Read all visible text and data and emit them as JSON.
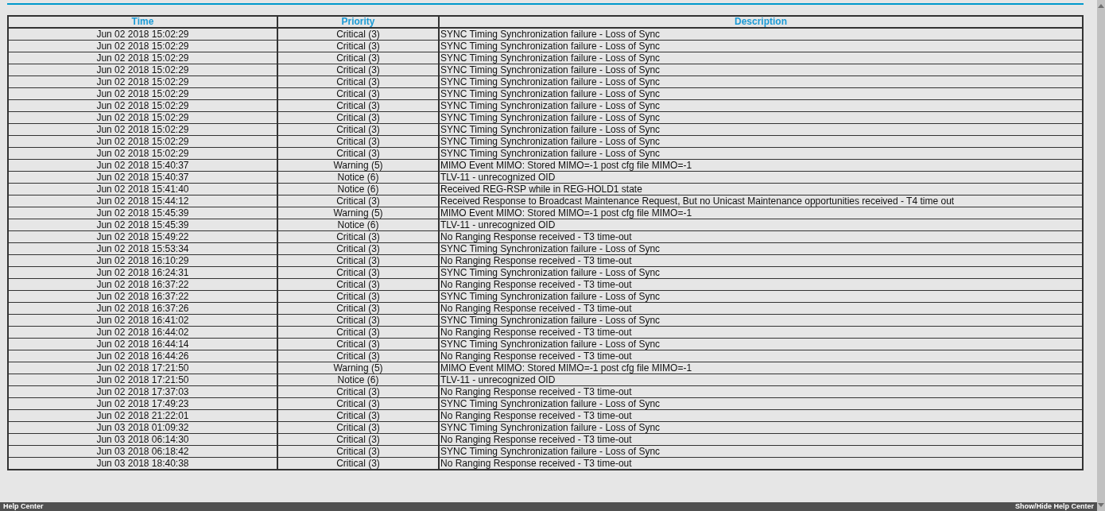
{
  "table": {
    "columns": [
      "Time",
      "Priority",
      "Description"
    ],
    "rows": [
      [
        "Jun 02 2018 15:02:29",
        "Critical (3)",
        "SYNC Timing Synchronization failure - Loss of Sync"
      ],
      [
        "Jun 02 2018 15:02:29",
        "Critical (3)",
        "SYNC Timing Synchronization failure - Loss of Sync"
      ],
      [
        "Jun 02 2018 15:02:29",
        "Critical (3)",
        "SYNC Timing Synchronization failure - Loss of Sync"
      ],
      [
        "Jun 02 2018 15:02:29",
        "Critical (3)",
        "SYNC Timing Synchronization failure - Loss of Sync"
      ],
      [
        "Jun 02 2018 15:02:29",
        "Critical (3)",
        "SYNC Timing Synchronization failure - Loss of Sync"
      ],
      [
        "Jun 02 2018 15:02:29",
        "Critical (3)",
        "SYNC Timing Synchronization failure - Loss of Sync"
      ],
      [
        "Jun 02 2018 15:02:29",
        "Critical (3)",
        "SYNC Timing Synchronization failure - Loss of Sync"
      ],
      [
        "Jun 02 2018 15:02:29",
        "Critical (3)",
        "SYNC Timing Synchronization failure - Loss of Sync"
      ],
      [
        "Jun 02 2018 15:02:29",
        "Critical (3)",
        "SYNC Timing Synchronization failure - Loss of Sync"
      ],
      [
        "Jun 02 2018 15:02:29",
        "Critical (3)",
        "SYNC Timing Synchronization failure - Loss of Sync"
      ],
      [
        "Jun 02 2018 15:02:29",
        "Critical (3)",
        "SYNC Timing Synchronization failure - Loss of Sync"
      ],
      [
        "Jun 02 2018 15:40:37",
        "Warning (5)",
        "MIMO Event MIMO: Stored MIMO=-1 post cfg file MIMO=-1"
      ],
      [
        "Jun 02 2018 15:40:37",
        "Notice (6)",
        "TLV-11 - unrecognized OID"
      ],
      [
        "Jun 02 2018 15:41:40",
        "Notice (6)",
        "Received REG-RSP while in REG-HOLD1 state"
      ],
      [
        "Jun 02 2018 15:44:12",
        "Critical (3)",
        "Received Response to Broadcast Maintenance Request, But no Unicast Maintenance opportunities received - T4 time out"
      ],
      [
        "Jun 02 2018 15:45:39",
        "Warning (5)",
        "MIMO Event MIMO: Stored MIMO=-1 post cfg file MIMO=-1"
      ],
      [
        "Jun 02 2018 15:45:39",
        "Notice (6)",
        "TLV-11 - unrecognized OID"
      ],
      [
        "Jun 02 2018 15:49:22",
        "Critical (3)",
        "No Ranging Response received - T3 time-out"
      ],
      [
        "Jun 02 2018 15:53:34",
        "Critical (3)",
        "SYNC Timing Synchronization failure - Loss of Sync"
      ],
      [
        "Jun 02 2018 16:10:29",
        "Critical (3)",
        "No Ranging Response received - T3 time-out"
      ],
      [
        "Jun 02 2018 16:24:31",
        "Critical (3)",
        "SYNC Timing Synchronization failure - Loss of Sync"
      ],
      [
        "Jun 02 2018 16:37:22",
        "Critical (3)",
        "No Ranging Response received - T3 time-out"
      ],
      [
        "Jun 02 2018 16:37:22",
        "Critical (3)",
        "SYNC Timing Synchronization failure - Loss of Sync"
      ],
      [
        "Jun 02 2018 16:37:26",
        "Critical (3)",
        "No Ranging Response received - T3 time-out"
      ],
      [
        "Jun 02 2018 16:41:02",
        "Critical (3)",
        "SYNC Timing Synchronization failure - Loss of Sync"
      ],
      [
        "Jun 02 2018 16:44:02",
        "Critical (3)",
        "No Ranging Response received - T3 time-out"
      ],
      [
        "Jun 02 2018 16:44:14",
        "Critical (3)",
        "SYNC Timing Synchronization failure - Loss of Sync"
      ],
      [
        "Jun 02 2018 16:44:26",
        "Critical (3)",
        "No Ranging Response received - T3 time-out"
      ],
      [
        "Jun 02 2018 17:21:50",
        "Warning (5)",
        "MIMO Event MIMO: Stored MIMO=-1 post cfg file MIMO=-1"
      ],
      [
        "Jun 02 2018 17:21:50",
        "Notice (6)",
        "TLV-11 - unrecognized OID"
      ],
      [
        "Jun 02 2018 17:37:03",
        "Critical (3)",
        "No Ranging Response received - T3 time-out"
      ],
      [
        "Jun 02 2018 17:49:23",
        "Critical (3)",
        "SYNC Timing Synchronization failure - Loss of Sync"
      ],
      [
        "Jun 02 2018 21:22:01",
        "Critical (3)",
        "No Ranging Response received - T3 time-out"
      ],
      [
        "Jun 03 2018 01:09:32",
        "Critical (3)",
        "SYNC Timing Synchronization failure - Loss of Sync"
      ],
      [
        "Jun 03 2018 06:14:30",
        "Critical (3)",
        "No Ranging Response received - T3 time-out"
      ],
      [
        "Jun 03 2018 06:18:42",
        "Critical (3)",
        "SYNC Timing Synchronization failure - Loss of Sync"
      ],
      [
        "Jun 03 2018 18:40:38",
        "Critical (3)",
        "No Ranging Response received - T3 time-out"
      ]
    ]
  },
  "footer": {
    "left": "Help Center",
    "right": "Show/Hide Help Center"
  }
}
